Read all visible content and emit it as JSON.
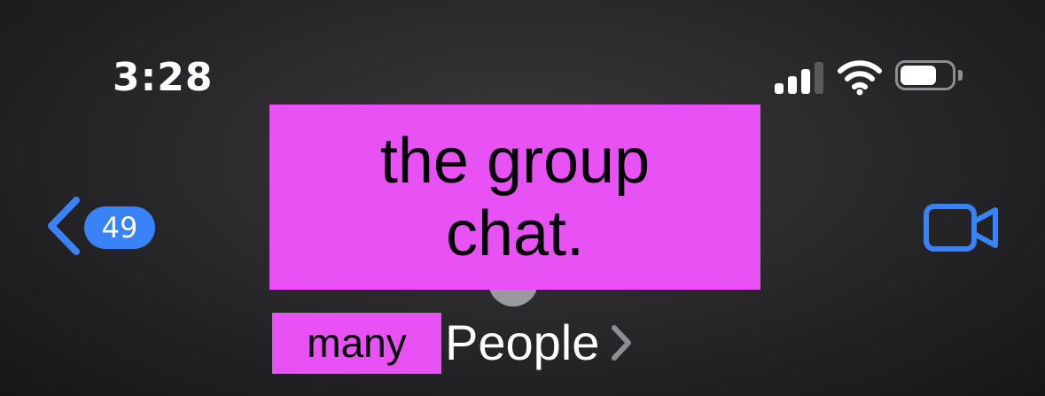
{
  "status_bar": {
    "time": "3:28",
    "signal_icon": "cellular-signal-icon",
    "wifi_icon": "wifi-icon",
    "battery_icon": "battery-icon"
  },
  "nav": {
    "back_icon": "chevron-left-icon",
    "unread_count": "49",
    "video_icon": "video-camera-icon",
    "accent_color": "#3a82f7"
  },
  "conversation": {
    "title": "the group chat.",
    "subtitle_prefix": "many",
    "subtitle": "People",
    "subtitle_chevron_icon": "chevron-right-icon",
    "redaction_color": "#e851f4"
  }
}
